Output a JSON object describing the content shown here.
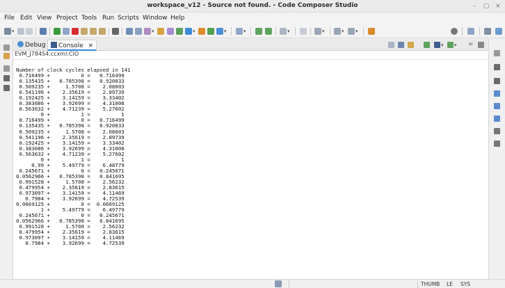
{
  "window": {
    "title": "workspace_v12 - Source not found. - Code Composer Studio",
    "minimize_glyph": "–",
    "maximize_glyph": "▢",
    "close_glyph": "×"
  },
  "menu": [
    "File",
    "Edit",
    "View",
    "Project",
    "Tools",
    "Run",
    "Scripts",
    "Window",
    "Help"
  ],
  "tabs": {
    "debug_label": "Debug",
    "console_label": "Console",
    "close_glyph": "×"
  },
  "console": {
    "path": "EVM_J784S4.ccxml:CIO",
    "header": "Number of clock cycles elapsed in 141",
    "rows": [
      [
        "0.716499",
        "0",
        "0.716499"
      ],
      [
        "0.135435",
        "0.785398",
        "0.920833"
      ],
      [
        "0.509235",
        "1.5708",
        "2.08003"
      ],
      [
        "0.541196",
        "2.35619",
        "2.89739"
      ],
      [
        "0.192425",
        "3.14159",
        "3.33402"
      ],
      [
        "0.383086",
        "3.92699",
        "4.31008"
      ],
      [
        "0.563632",
        "4.71239",
        "5.27602"
      ],
      [
        "0",
        "1",
        "1"
      ],
      [
        "0.716499",
        "0",
        "0.716499"
      ],
      [
        "0.135435",
        "0.785398",
        "0.920833"
      ],
      [
        "0.509235",
        "1.5708",
        "2.08003"
      ],
      [
        "0.541196",
        "2.35619",
        "2.89739"
      ],
      [
        "0.192425",
        "3.14159",
        "3.33402"
      ],
      [
        "0.383086",
        "3.92699",
        "4.31008"
      ],
      [
        "0.563632",
        "4.71239",
        "5.27602"
      ],
      [
        "0",
        "1",
        "1"
      ],
      [
        "0.99",
        "5.49779",
        "6.48779"
      ],
      [
        "0.245671",
        "0",
        "0.245671"
      ],
      [
        "0.0562966",
        "0.785398",
        "0.841695"
      ],
      [
        "0.991528",
        "1.5708",
        "2.56232"
      ],
      [
        "0.479954",
        "2.35619",
        "2.83615"
      ],
      [
        "0.973097",
        "3.14159",
        "4.11469"
      ],
      [
        "0.7984",
        "3.92699",
        "4.72539"
      ],
      [
        "0.0669125",
        "0",
        "0.0669125"
      ],
      [
        "1",
        "5.49779",
        "6.49779"
      ],
      [
        "0.245671",
        "0",
        "0.245671"
      ],
      [
        "0.0562966",
        "0.785398",
        "0.841695"
      ],
      [
        "0.991528",
        "1.5708",
        "2.56232"
      ],
      [
        "0.479954",
        "2.35619",
        "2.83615"
      ],
      [
        "0.973097",
        "3.14159",
        "4.11469"
      ],
      [
        "0.7984",
        "3.92699",
        "4.72539"
      ]
    ]
  },
  "status": {
    "thumb": "THUMB",
    "le": "LE",
    "sys": "SYS"
  },
  "colors": {
    "accent": "#3584e4",
    "run_green": "#3a9a3a",
    "terminate_red": "#d62d2d"
  }
}
